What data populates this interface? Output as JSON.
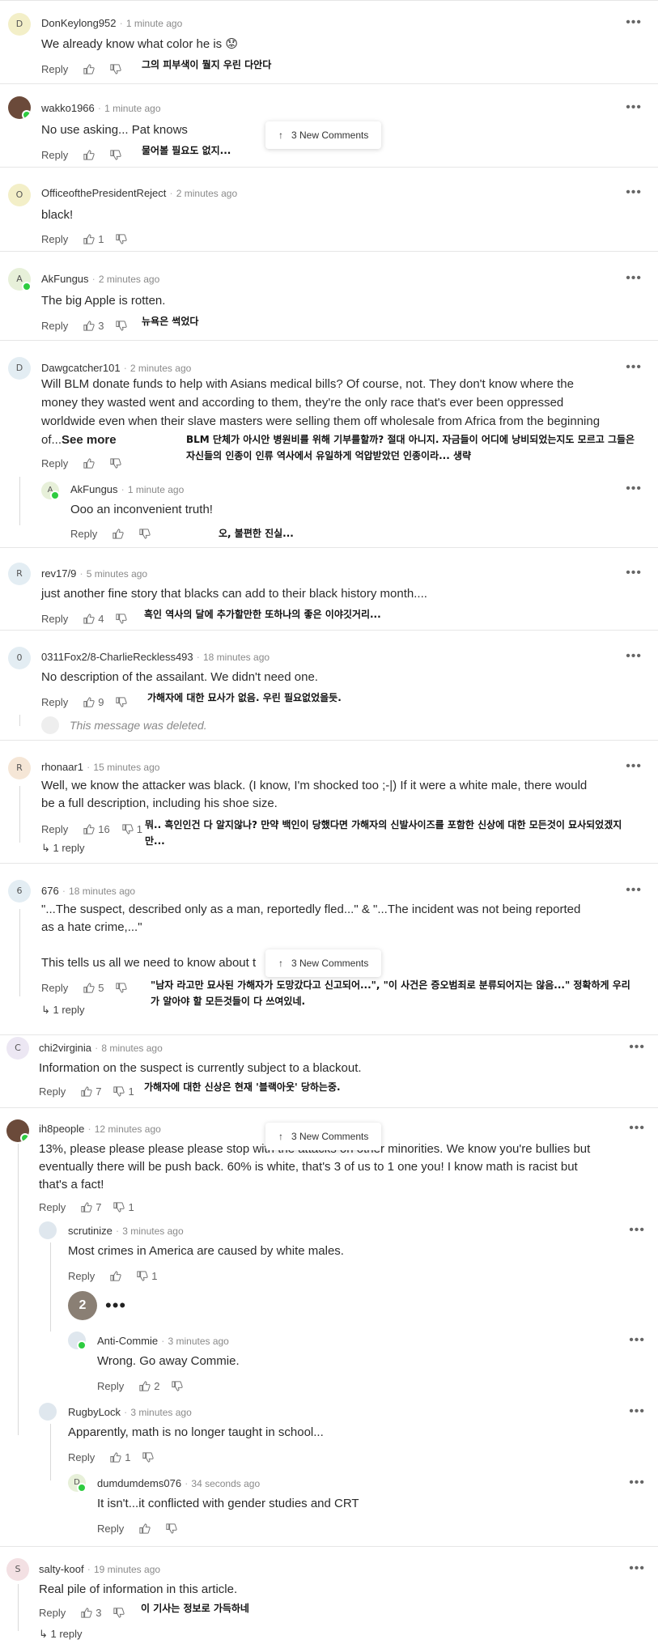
{
  "toast_label": "3 New Comments",
  "comments": [
    {
      "user": "DonKeylong952",
      "time": "1 minute ago",
      "text": "We already know what color he is 😟",
      "reply": "Reply",
      "likes": "",
      "dislikes": "",
      "ko": "그의 피부색이 뭘지 우린 다안다",
      "initial": "D"
    },
    {
      "user": "wakko1966",
      "time": "1 minute ago",
      "text": "No use asking... Pat knows",
      "reply": "Reply",
      "likes": "",
      "dislikes": "",
      "ko": "물어볼 필요도 없지...",
      "initial": ""
    },
    {
      "user": "OfficeofthePresidentReject",
      "time": "2 minutes ago",
      "text": "black!",
      "reply": "Reply",
      "likes": "1",
      "dislikes": "",
      "ko": "",
      "initial": "O"
    },
    {
      "user": "AkFungus",
      "time": "2 minutes ago",
      "text": "The big Apple is rotten.",
      "reply": "Reply",
      "likes": "3",
      "dislikes": "",
      "ko": "뉴욕은 썩었다",
      "initial": "A"
    },
    {
      "user": "Dawgcatcher101",
      "time": "2 minutes ago",
      "text": "Will BLM donate funds to help with Asians medical bills? Of course, not. They don't know where the money they wasted went and according to them, they're the only race that's ever been oppressed worldwide even when their slave masters were selling them off wholesale from Africa from the beginning of...",
      "see_more": "See more",
      "reply": "Reply",
      "likes": "",
      "dislikes": "",
      "ko": "BLM 단체가 아시안 병원비를 위해 기부를할까? 절대 아니지. 자금들이 어디에 낭비되었는지도 모르고 그들은 자신들의 인종이 인류 역사에서 유일하게 억압받았던 인종이라... 생략",
      "initial": "D"
    },
    {
      "user": "AkFungus",
      "time": "1 minute ago",
      "text": "Ooo an inconvenient truth!",
      "reply": "Reply",
      "likes": "",
      "dislikes": "",
      "ko": "오, 불편한 진실...",
      "initial": "A"
    },
    {
      "user": "rev17/9",
      "time": "5 minutes ago",
      "text": "just another fine story that blacks can add to their black history month....",
      "reply": "Reply",
      "likes": "4",
      "dislikes": "",
      "ko": "흑인 역사의 달에 추가할만한 또하나의 좋은 이야깃거리...",
      "initial": "R"
    },
    {
      "user": "0311Fox2/8-CharlieReckless493",
      "time": "18 minutes ago",
      "text": "No description of the assailant. We didn't need one.",
      "reply": "Reply",
      "likes": "9",
      "dislikes": "",
      "ko": "가해자에 대한 묘사가 없음. 우린 필요없었을듯.",
      "deleted": "This message was deleted.",
      "initial": "0"
    },
    {
      "user": "rhonaar1",
      "time": "15 minutes ago",
      "text": "Well, we know the attacker was black. (I know, I'm shocked too ;-|) If it were a white male, there would be a full description, including his shoe size.",
      "reply": "Reply",
      "likes": "16",
      "dislikes": "1",
      "replies": "1 reply",
      "ko": "뭐.. 흑인인건 다 알지않나? 만약 백인이 당했다면 가해자의 신발사이즈를 포함한 신상에 대한 모든것이 묘사되었겠지만...",
      "initial": "R"
    },
    {
      "user": "676",
      "time": "18 minutes ago",
      "text": "\"...The suspect, described only as a man, reportedly fled...\"  &   \"...The incident was not being reported as a hate crime,...\"",
      "text2": "This tells us all we need to know about t",
      "reply": "Reply",
      "likes": "5",
      "dislikes": "",
      "replies": "1 reply",
      "ko": "\"남자 라고만 묘사된 가해자가 도망갔다고 신고되어...\", \"이 사건은 증오범죄로 분류되어지는 않음...\" 정확하게 우리가 알아야 할 모든것들이 다 쓰여있네.",
      "initial": "6"
    },
    {
      "user": "chi2virginia",
      "time": "8 minutes ago",
      "text": "Information on the suspect is currently subject to a blackout.",
      "reply": "Reply",
      "likes": "7",
      "dislikes": "1",
      "ko": "가해자에 대한 신상은 현재 '블랙아웃' 당하는중.",
      "initial": "C"
    },
    {
      "user": "ih8people",
      "time": "12 minutes ago",
      "text": "13%, please please please please stop with the attacks on other minorities.  We know you're bullies but eventually there will be push back.  60% is white, that's 3 of us to 1 one you!  I know math is racist but that's a fact!",
      "reply": "Reply",
      "likes": "7",
      "dislikes": "1",
      "initial": ""
    },
    {
      "user": "scrutinize",
      "time": "3 minutes ago",
      "text": "Most crimes in America are caused by white males.",
      "reply": "Reply",
      "likes": "",
      "dislikes": "1",
      "initial": ""
    },
    {
      "user": "Anti-Commie",
      "time": "3 minutes ago",
      "text": "Wrong.  Go away Commie.",
      "reply": "Reply",
      "likes": "2",
      "dislikes": "",
      "initial": ""
    },
    {
      "user": "RugbyLock",
      "time": "3 minutes ago",
      "text": "Apparently, math is no longer taught in school...",
      "reply": "Reply",
      "likes": "1",
      "dislikes": "",
      "initial": ""
    },
    {
      "user": "dumdumdems076",
      "time": "34 seconds ago",
      "text": "It isn't...it conflicted with gender studies and CRT",
      "reply": "Reply",
      "likes": "",
      "dislikes": "",
      "initial": "D"
    },
    {
      "user": "salty-koof",
      "time": "19 minutes ago",
      "text": "Real pile of information in this article.",
      "reply": "Reply",
      "likes": "3",
      "dislikes": "",
      "replies": "1 reply",
      "ko": "이 기사는 정보로 가득하네",
      "initial": "S"
    }
  ],
  "typing": {
    "count": "2",
    "dots": "•••"
  },
  "colors": {
    "online": "#2ecc40",
    "avatar_yellow": "#f3efc8",
    "avatar_green": "#e7f0d9",
    "avatar_blue": "#e3edf3",
    "avatar_pink": "#f3e0e3",
    "avatar_orange": "#f5e6d6"
  }
}
